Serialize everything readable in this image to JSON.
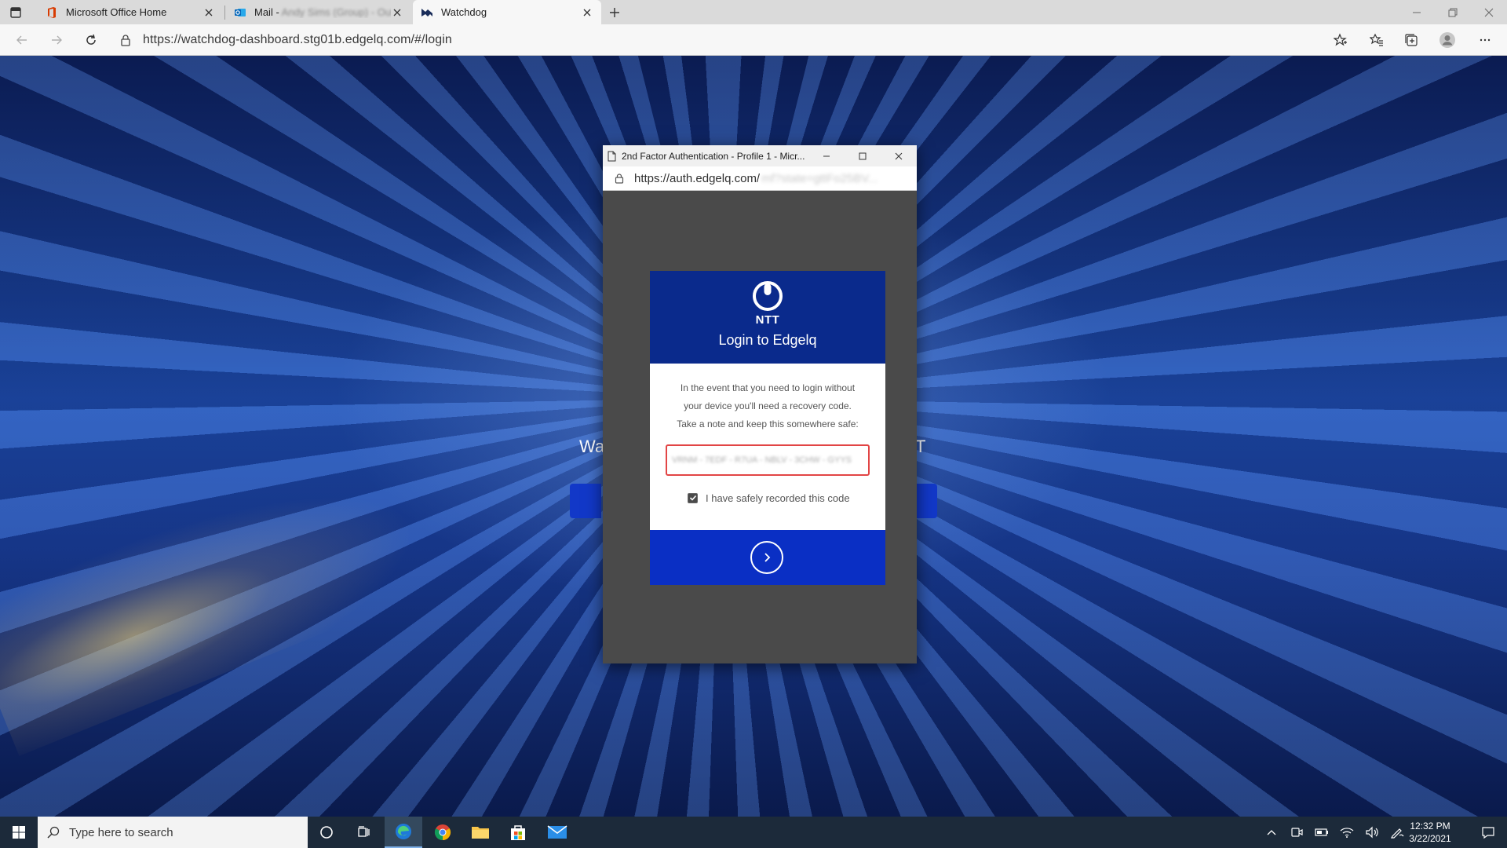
{
  "browser": {
    "tabs": [
      {
        "title": "Microsoft Office Home",
        "icon": "office-icon"
      },
      {
        "title": "Mail - ",
        "title_blurred": "Andy Sims (Group) - Outlo",
        "icon": "outlook-icon"
      },
      {
        "title": "Watchdog",
        "icon": "watchdog-icon"
      }
    ],
    "url": "https://watchdog-dashboard.stg01b.edgelq.com/#/login"
  },
  "page": {
    "heading_left": "Wa",
    "heading_right": "T"
  },
  "popup": {
    "window_title": "2nd Factor Authentication - Profile 1 - Micr...",
    "url_visible": "https://auth.edgelq.com/",
    "url_blurred": "mf?state=gttFo25BV...",
    "brand": "NTT",
    "card_title": "Login to Edgelq",
    "message_line1": "In the event that you need to login without",
    "message_line2": "your device you'll need a recovery code.",
    "message_line3": "Take a note and keep this somewhere safe:",
    "recovery_code_blurred": "VRNM - 7EDF - R7UA - NBLV - 3CHW - GYYS",
    "checkbox_label": "I have safely recorded this code",
    "checkbox_checked": true
  },
  "taskbar": {
    "search_placeholder": "Type here to search",
    "time": "12:32 PM",
    "date": "3/22/2021"
  },
  "colors": {
    "card_header": "#0a2a8c",
    "card_footer": "#0a2fc4",
    "input_border": "#e24545",
    "popup_bg": "#4a4a4a",
    "taskbar": "#1c2a3a"
  }
}
